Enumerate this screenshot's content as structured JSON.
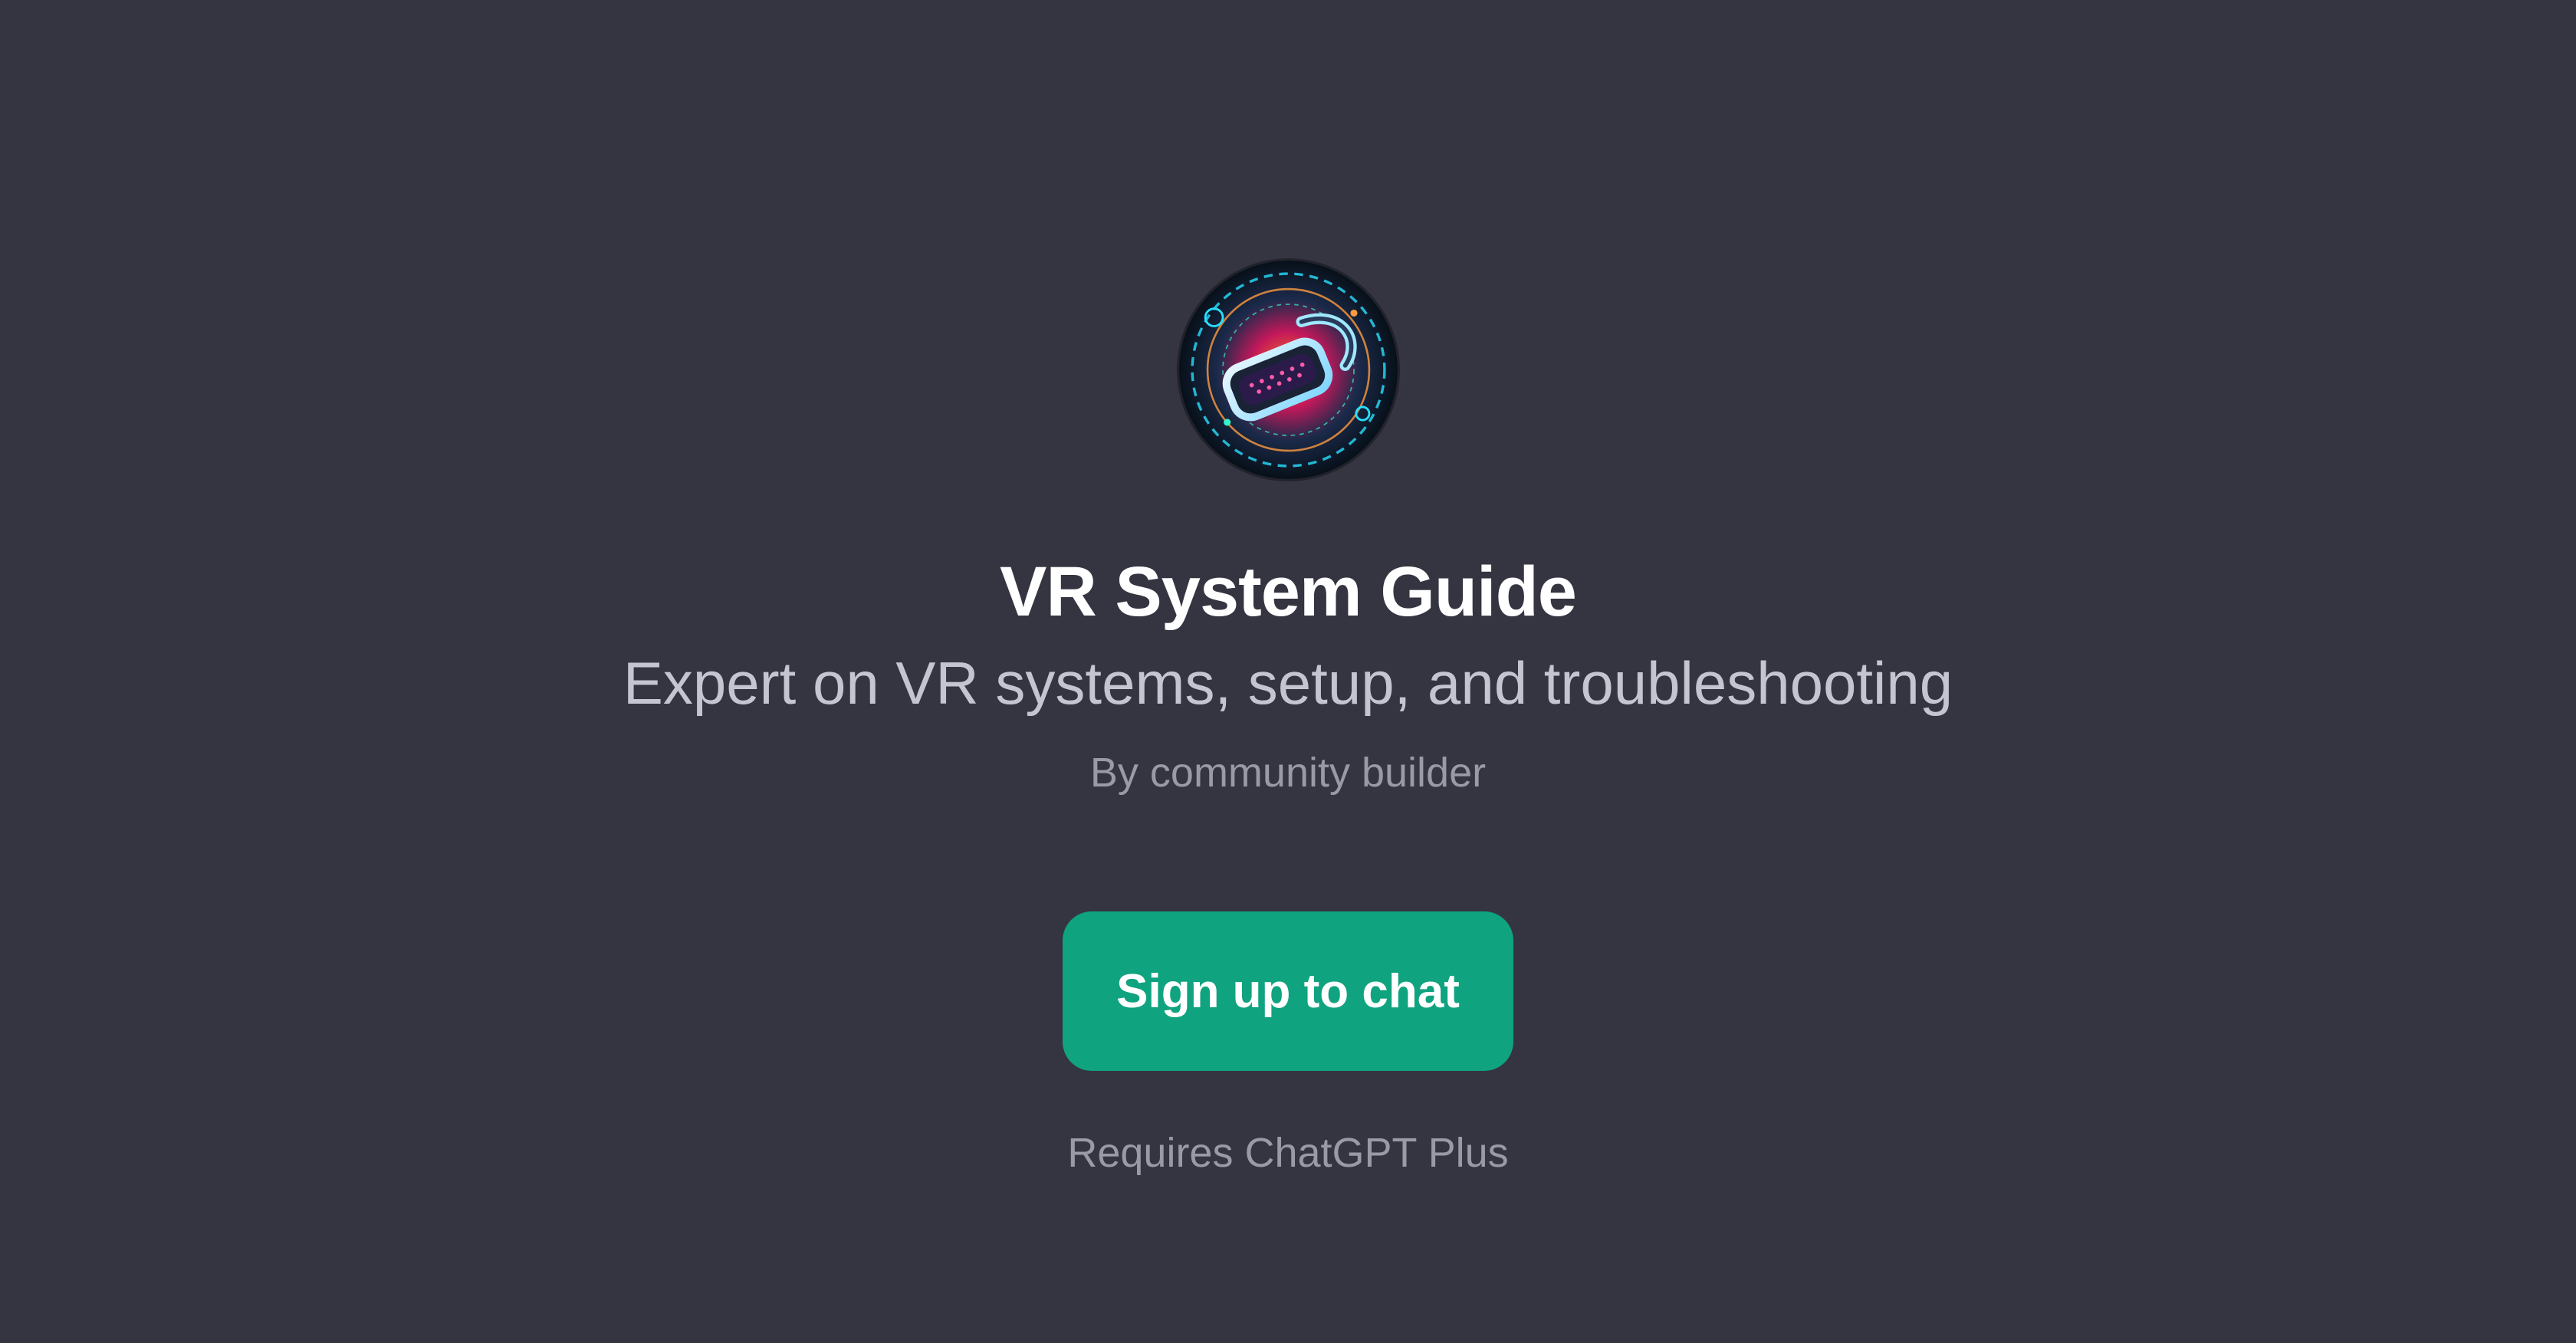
{
  "gpt": {
    "title": "VR System Guide",
    "description": "Expert on VR systems, setup, and troubleshooting",
    "author": "By community builder",
    "avatar_icon": "vr-headset-icon"
  },
  "actions": {
    "signup_label": "Sign up to chat"
  },
  "footer": {
    "requirement": "Requires ChatGPT Plus"
  },
  "colors": {
    "background": "#343541",
    "accent": "#10a37f",
    "title": "#ffffff",
    "subtitle": "#c5c5d2",
    "muted": "#9a9aa6"
  }
}
